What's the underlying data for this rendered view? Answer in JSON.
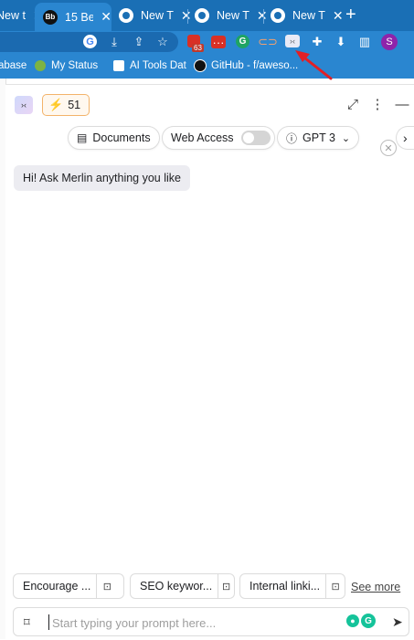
{
  "browser": {
    "tabs": [
      {
        "label": "New t",
        "close": "✕"
      },
      {
        "label": "15 Be",
        "close": "✕",
        "favicon_text": "Bb"
      },
      {
        "label": "New T",
        "close": "✕"
      },
      {
        "label": "New T",
        "close": "✕"
      },
      {
        "label": "New T",
        "close": "✕"
      }
    ],
    "newtab_glyph": "+",
    "extensions": {
      "ario_badge": "63",
      "profile_initial": "S"
    },
    "bookmarks": [
      {
        "label": "abase"
      },
      {
        "label": "My Status"
      },
      {
        "label": "AI Tools Dat"
      },
      {
        "label": "GitHub - f/aweso..."
      }
    ]
  },
  "merlin": {
    "credits": "51",
    "chips": {
      "documents": "Documents",
      "web_access": "Web Access",
      "model": "GPT 3"
    },
    "greeting": "Hi! Ask Merlin anything you like",
    "suggestions": [
      {
        "label": "Encourage ..."
      },
      {
        "label": "SEO keywor..."
      },
      {
        "label": "Internal linki..."
      }
    ],
    "see_more": "See more",
    "prompt_placeholder": "Start typing your prompt here...",
    "web_access_enabled": false
  },
  "colors": {
    "tabstrip": "#1a6fb5",
    "toolbar": "#2a86d0",
    "annotation_arrow": "#e21f26",
    "credits_border": "#f3b36a"
  }
}
